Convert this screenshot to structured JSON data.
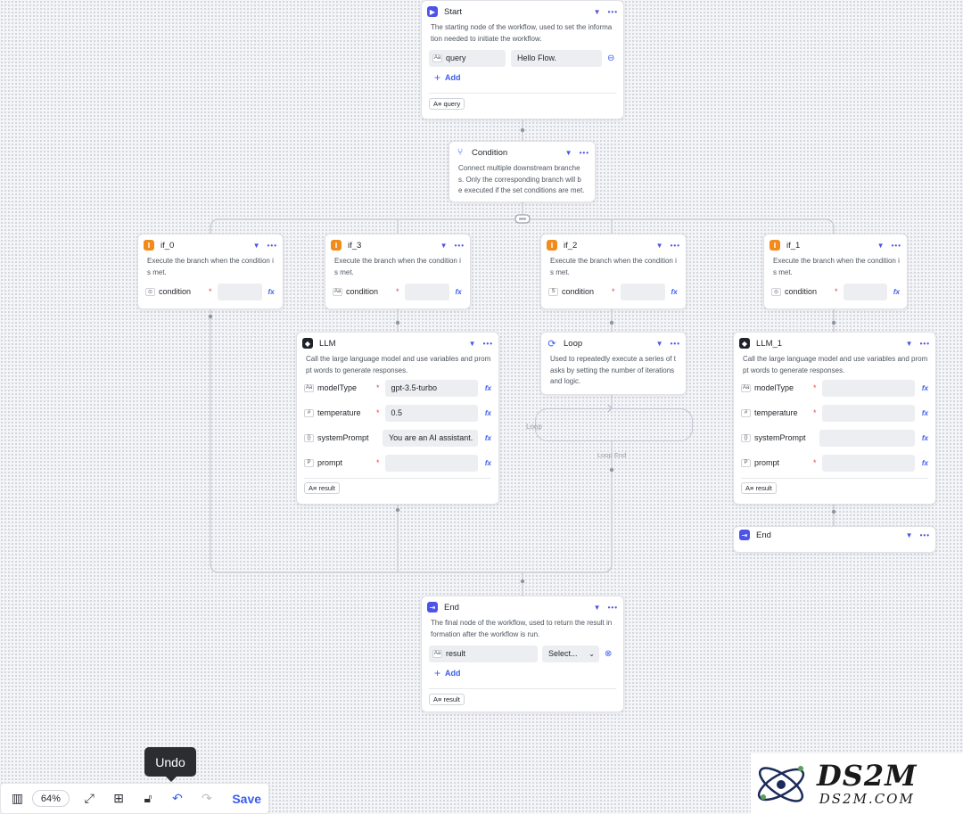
{
  "nodes": {
    "start": {
      "title": "Start",
      "desc_line1": "The starting node of the workflow, used to set the informa",
      "desc_line2": "tion needed to initiate the workflow.",
      "field_name": "query",
      "field_value": "Hello Flow.",
      "add_label": "Add",
      "output_tag": "query"
    },
    "condition": {
      "title": "Condition",
      "desc_line1": "Connect multiple downstream branche",
      "desc_line2": "s. Only the corresponding branch will b",
      "desc_line3": "e executed if the set conditions are met."
    },
    "if0": {
      "title": "if_0",
      "desc_line1": "Execute the branch when the condition i",
      "desc_line2": "s met.",
      "field": "condition"
    },
    "if3": {
      "title": "if_3",
      "desc_line1": "Execute the branch when the condition i",
      "desc_line2": "s met.",
      "field": "condition"
    },
    "if2": {
      "title": "if_2",
      "desc_line1": "Execute the branch when the condition i",
      "desc_line2": "s met.",
      "field": "condition"
    },
    "if1": {
      "title": "if_1",
      "desc_line1": "Execute the branch when the condition i",
      "desc_line2": "s met.",
      "field": "condition"
    },
    "llm": {
      "title": "LLM",
      "desc_line1": "Call the large language model and use variables and prom",
      "desc_line2": "pt words to generate responses.",
      "fields": [
        {
          "name": "modelType",
          "value": "gpt-3.5-turbo"
        },
        {
          "name": "temperature",
          "value": "0.5"
        },
        {
          "name": "systemPrompt",
          "value": "You are an AI assistant."
        },
        {
          "name": "prompt",
          "value": ""
        }
      ],
      "output_tag": "result"
    },
    "loop": {
      "title": "Loop",
      "desc_line1": "Used to repeatedly execute a series of t",
      "desc_line2": "asks by setting the number of iterations",
      "desc_line3": "and logic.",
      "body_label": "Loop",
      "body_sub": "Loop End"
    },
    "llm1": {
      "title": "LLM_1",
      "desc_line1": "Call the large language model and use variables and prom",
      "desc_line2": "pt words to generate responses.",
      "fields": [
        {
          "name": "modelType",
          "value": ""
        },
        {
          "name": "temperature",
          "value": ""
        },
        {
          "name": "systemPrompt",
          "value": ""
        },
        {
          "name": "prompt",
          "value": ""
        }
      ],
      "output_tag": "result"
    },
    "end_small": {
      "title": "End"
    },
    "end": {
      "title": "End",
      "desc_line1": "The final node of the workflow, used to return the result in",
      "desc_line2": "formation after the workflow is run.",
      "field_name": "result",
      "select_placeholder": "Select...",
      "add_label": "Add",
      "output_tag": "result"
    }
  },
  "toolbar": {
    "zoom": "64%",
    "save_label": "Save",
    "tooltip": "Undo"
  },
  "watermark": {
    "big": "DS2M",
    "small": "DS2M.COM"
  },
  "colors": {
    "accent": "#4d53e8",
    "link": "#3b5cf0",
    "branch": "#f18b1c"
  }
}
